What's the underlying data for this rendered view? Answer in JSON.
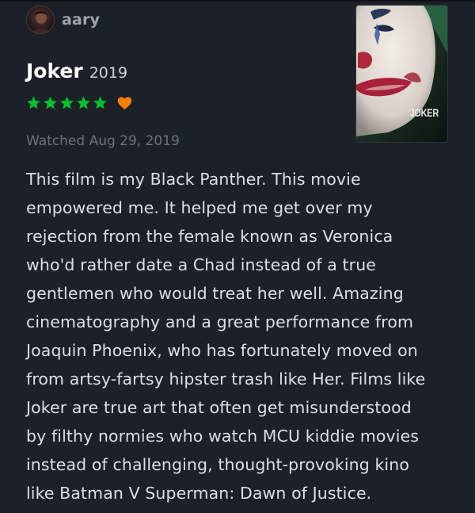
{
  "user": {
    "name": "aary",
    "avatar_icon": "avatar-icon"
  },
  "film": {
    "title": "Joker",
    "year": "2019",
    "poster_title": "JOKER"
  },
  "rating": {
    "stars": 5,
    "max_stars": 5,
    "liked": true,
    "star_color": "#00c030",
    "heart_color": "#ff8000",
    "star_icon": "star-icon",
    "heart_icon": "heart-icon"
  },
  "watched_text": "Watched Aug 29, 2019",
  "review_text": "This film is my Black Panther. This movie\nempowered me. It helped me get over my\nrejection from the female known as Veronica\nwho'd rather date a Chad instead of a true\ngentlemen who would treat her well. Amazing\ncinematography and a great performance from\nJoaquin Phoenix, who has fortunately moved on\nfrom artsy-fartsy hipster trash like Her. Films like\nJoker are true art that often get misunderstood\nby filthy normies who watch MCU kiddie movies\ninstead of challenging, thought-provoking kino\nlike Batman V Superman: Dawn of Justice."
}
